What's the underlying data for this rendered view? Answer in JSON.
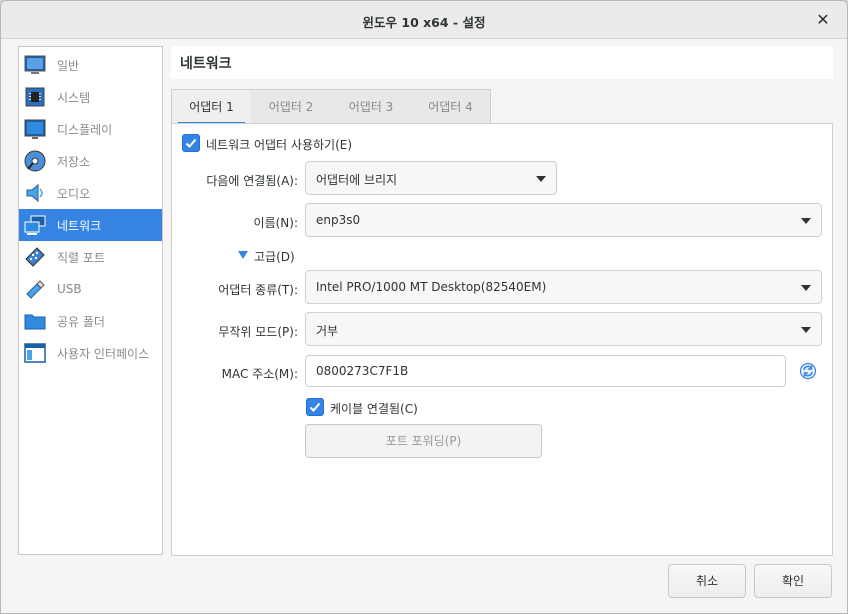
{
  "window": {
    "title": "윈도우 10 x64 - 설정"
  },
  "sidebar": {
    "items": [
      {
        "label": "일반",
        "icon": "general-icon"
      },
      {
        "label": "시스템",
        "icon": "system-icon"
      },
      {
        "label": "디스플레이",
        "icon": "display-icon"
      },
      {
        "label": "저장소",
        "icon": "storage-icon"
      },
      {
        "label": "오디오",
        "icon": "audio-icon"
      },
      {
        "label": "네트워크",
        "icon": "network-icon"
      },
      {
        "label": "직렬 포트",
        "icon": "serial-port-icon"
      },
      {
        "label": "USB",
        "icon": "usb-icon"
      },
      {
        "label": "공유 폴더",
        "icon": "shared-folder-icon"
      },
      {
        "label": "사용자 인터페이스",
        "icon": "user-interface-icon"
      }
    ],
    "active_index": 5
  },
  "page": {
    "title": "네트워크"
  },
  "tabs": [
    {
      "label": "어댑터 1"
    },
    {
      "label": "어댑터 2"
    },
    {
      "label": "어댑터 3"
    },
    {
      "label": "어댑터 4"
    }
  ],
  "form": {
    "enable_adapter": {
      "label": "네트워크 어댑터 사용하기(E)",
      "checked": true
    },
    "attached_to": {
      "label": "다음에 연결됨(A):",
      "value": "어댑터에 브리지"
    },
    "name": {
      "label": "이름(N):",
      "value": "enp3s0"
    },
    "advanced": {
      "label": "고급(D)"
    },
    "adapter_type": {
      "label": "어댑터 종류(T):",
      "value": "Intel PRO/1000 MT Desktop(82540EM)"
    },
    "promiscuous": {
      "label": "무작위 모드(P):",
      "value": "거부"
    },
    "mac": {
      "label": "MAC 주소(M):",
      "value": "0800273C7F1B"
    },
    "cable_connected": {
      "label": "케이블 연결됨(C)",
      "checked": true
    },
    "port_forwarding": {
      "label": "포트 포워딩(P)"
    }
  },
  "footer": {
    "cancel_label": "취소",
    "ok_label": "확인"
  },
  "colors": {
    "accent": "#3584e4",
    "window_bg": "#f6f5f4"
  }
}
